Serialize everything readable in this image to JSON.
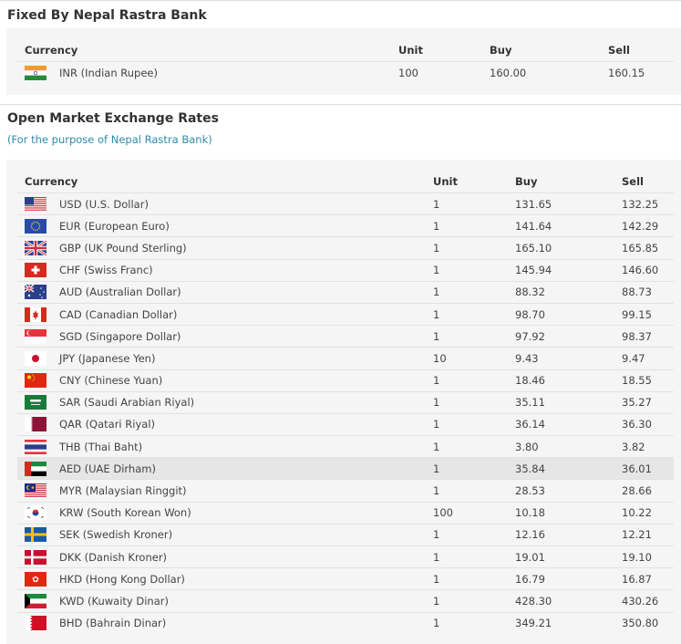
{
  "fixed": {
    "title": "Fixed By Nepal Rastra Bank",
    "headers": {
      "currency": "Currency",
      "unit": "Unit",
      "buy": "Buy",
      "sell": "Sell"
    },
    "rows": [
      {
        "code": "INR",
        "label": "INR (Indian Rupee)",
        "unit": "100",
        "buy": "160.00",
        "sell": "160.15",
        "flag": "india-flag"
      }
    ]
  },
  "open": {
    "title": "Open Market Exchange Rates",
    "subtitle": "(For the purpose of Nepal Rastra Bank)",
    "headers": {
      "currency": "Currency",
      "unit": "Unit",
      "buy": "Buy",
      "sell": "Sell"
    },
    "highlighted_row": "AED",
    "rows": [
      {
        "code": "USD",
        "label": "USD (U.S. Dollar)",
        "unit": "1",
        "buy": "131.65",
        "sell": "132.25"
      },
      {
        "code": "EUR",
        "label": "EUR (European Euro)",
        "unit": "1",
        "buy": "141.64",
        "sell": "142.29"
      },
      {
        "code": "GBP",
        "label": "GBP (UK Pound Sterling)",
        "unit": "1",
        "buy": "165.10",
        "sell": "165.85"
      },
      {
        "code": "CHF",
        "label": "CHF (Swiss Franc)",
        "unit": "1",
        "buy": "145.94",
        "sell": "146.60"
      },
      {
        "code": "AUD",
        "label": "AUD (Australian Dollar)",
        "unit": "1",
        "buy": "88.32",
        "sell": "88.73"
      },
      {
        "code": "CAD",
        "label": "CAD (Canadian Dollar)",
        "unit": "1",
        "buy": "98.70",
        "sell": "99.15"
      },
      {
        "code": "SGD",
        "label": "SGD (Singapore Dollar)",
        "unit": "1",
        "buy": "97.92",
        "sell": "98.37"
      },
      {
        "code": "JPY",
        "label": "JPY (Japanese Yen)",
        "unit": "10",
        "buy": "9.43",
        "sell": "9.47"
      },
      {
        "code": "CNY",
        "label": "CNY (Chinese Yuan)",
        "unit": "1",
        "buy": "18.46",
        "sell": "18.55"
      },
      {
        "code": "SAR",
        "label": "SAR (Saudi Arabian Riyal)",
        "unit": "1",
        "buy": "35.11",
        "sell": "35.27"
      },
      {
        "code": "QAR",
        "label": "QAR (Qatari Riyal)",
        "unit": "1",
        "buy": "36.14",
        "sell": "36.30"
      },
      {
        "code": "THB",
        "label": "THB (Thai Baht)",
        "unit": "1",
        "buy": "3.80",
        "sell": "3.82"
      },
      {
        "code": "AED",
        "label": "AED (UAE Dirham)",
        "unit": "1",
        "buy": "35.84",
        "sell": "36.01"
      },
      {
        "code": "MYR",
        "label": "MYR (Malaysian Ringgit)",
        "unit": "1",
        "buy": "28.53",
        "sell": "28.66"
      },
      {
        "code": "KRW",
        "label": "KRW (South Korean Won)",
        "unit": "100",
        "buy": "10.18",
        "sell": "10.22"
      },
      {
        "code": "SEK",
        "label": "SEK (Swedish Kroner)",
        "unit": "1",
        "buy": "12.16",
        "sell": "12.21"
      },
      {
        "code": "DKK",
        "label": "DKK (Danish Kroner)",
        "unit": "1",
        "buy": "19.01",
        "sell": "19.10"
      },
      {
        "code": "HKD",
        "label": "HKD (Hong Kong Dollar)",
        "unit": "1",
        "buy": "16.79",
        "sell": "16.87"
      },
      {
        "code": "KWD",
        "label": "KWD (Kuwaity Dinar)",
        "unit": "1",
        "buy": "428.30",
        "sell": "430.26"
      },
      {
        "code": "BHD",
        "label": "BHD (Bahrain Dinar)",
        "unit": "1",
        "buy": "349.21",
        "sell": "350.80"
      }
    ]
  }
}
